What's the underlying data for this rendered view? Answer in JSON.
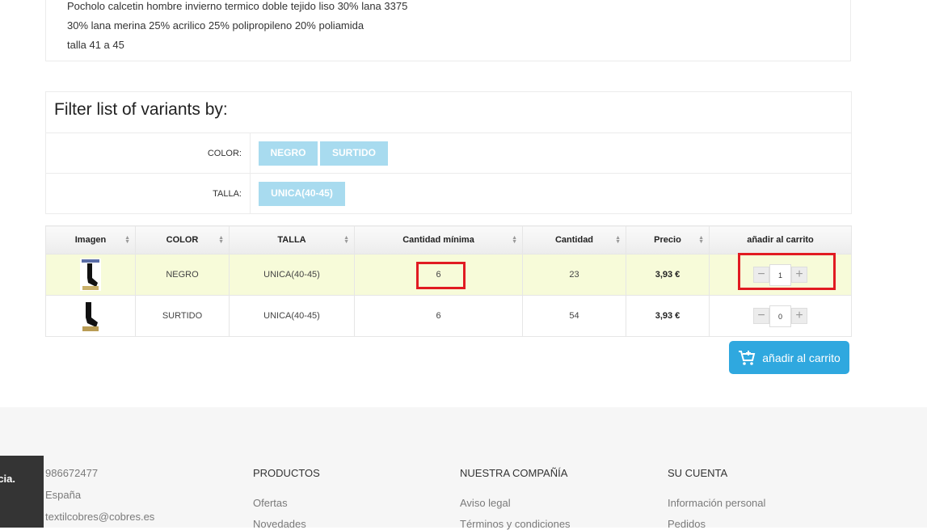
{
  "product": {
    "lines": [
      "Pocholo calcetin hombre invierno termico doble tejido liso 30% lana 3375",
      "30% lana merina 25% acrilico 25% polipropileno 20% poliamida",
      "talla 41 a 45"
    ]
  },
  "filter": {
    "title": "Filter list of variants by:",
    "color_label": "COLOR:",
    "color_options": [
      "NEGRO",
      "SURTIDO"
    ],
    "talla_label": "TALLA:",
    "talla_options": [
      "UNICA(40-45)"
    ]
  },
  "table": {
    "headers": [
      "Imagen",
      "COLOR",
      "TALLA",
      "Cantidad mínima",
      "Cantidad",
      "Precio",
      "añadir al carrito"
    ],
    "rows": [
      {
        "color": "NEGRO",
        "talla": "UNICA(40-45)",
        "min": "6",
        "cantidad": "23",
        "precio": "3,93 €",
        "qty": "1"
      },
      {
        "color": "SURTIDO",
        "talla": "UNICA(40-45)",
        "min": "6",
        "cantidad": "54",
        "precio": "3,93 €",
        "qty": "0"
      }
    ]
  },
  "add_to_cart": "añadir al carrito",
  "footer": {
    "contact": [
      "986672477",
      "España",
      "textilcobres@cobres.es"
    ],
    "productos_title": "PRODUCTOS",
    "productos": [
      "Ofertas",
      "Novedades"
    ],
    "compania_title": "NUESTRA COMPAÑÍA",
    "compania": [
      "Aviso legal",
      "Términos y condiciones"
    ],
    "cuenta_title": "SU CUENTA",
    "cuenta": [
      "Información personal",
      "Pedidos"
    ]
  },
  "cookie_text": "cia.",
  "colors": {
    "accent": "#2fa8df",
    "filter_chip": "#a8dbef",
    "highlight_row": "#f7fbd9",
    "annotation": "#e11b22"
  }
}
